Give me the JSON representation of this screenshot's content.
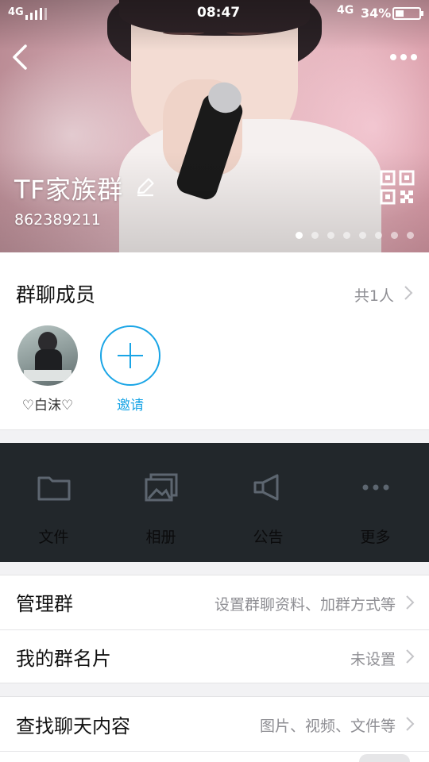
{
  "status_bar": {
    "network_left": "4G",
    "time": "08:47",
    "network_right": "4G",
    "battery_percent": "34%",
    "battery_level": 0.34
  },
  "header": {
    "group_name": "TF家族群",
    "group_id": "862389211",
    "carousel_total": 8,
    "carousel_active": 1
  },
  "members": {
    "title": "群聊成员",
    "count": "共1人",
    "items": [
      {
        "name": "♡白沫♡"
      }
    ],
    "invite_label": "邀请"
  },
  "features": [
    {
      "icon": "folder-icon",
      "label": "文件"
    },
    {
      "icon": "album-icon",
      "label": "相册"
    },
    {
      "icon": "announcement-icon",
      "label": "公告"
    },
    {
      "icon": "more-dots-icon",
      "label": "更多"
    }
  ],
  "settings": {
    "manage": {
      "label": "管理群",
      "value": "设置群聊资料、加群方式等"
    },
    "card": {
      "label": "我的群名片",
      "value": "未设置"
    },
    "search": {
      "label": "查找聊天内容",
      "value": "图片、视频、文件等"
    }
  },
  "colors": {
    "accent": "#1aa5e6",
    "feature_bg": "#22272b",
    "icon_gray": "#5d6670"
  }
}
